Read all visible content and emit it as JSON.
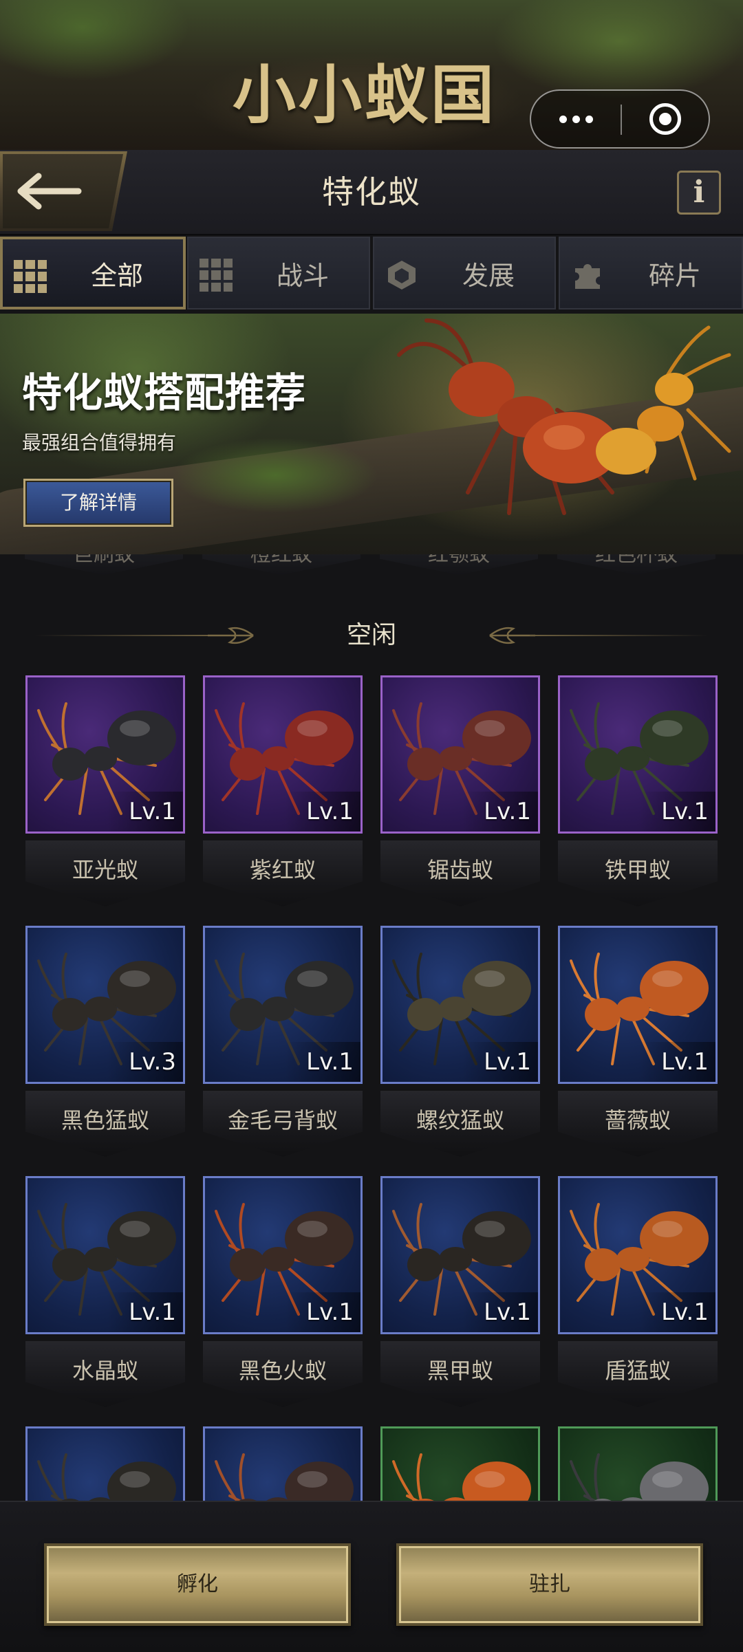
{
  "banner": {
    "logo_text": "小小蚁国"
  },
  "header": {
    "title": "特化蚁",
    "info_label": "i"
  },
  "tabs": [
    {
      "label": "全部",
      "icon": "grid-icon",
      "active": true
    },
    {
      "label": "战斗",
      "icon": "grid-icon",
      "active": false
    },
    {
      "label": "发展",
      "icon": "hexagon-icon",
      "active": false
    },
    {
      "label": "碎片",
      "icon": "puzzle-icon",
      "active": false
    }
  ],
  "promo": {
    "title": "特化蚁搭配推荐",
    "subtitle": "最强组合值得拥有",
    "button": "了解详情"
  },
  "partial_row": [
    "巨刷蚁",
    "橙红蚁",
    "红颚蚁",
    "红色杯蚁"
  ],
  "section": {
    "title": "空闲"
  },
  "ants": [
    {
      "name": "亚光蚁",
      "level": "Lv.1",
      "rarity": "purple",
      "body_color": "#2a2a2e",
      "leg_color": "#c07030"
    },
    {
      "name": "紫红蚁",
      "level": "Lv.1",
      "rarity": "purple",
      "body_color": "#8a2a22",
      "leg_color": "#a03428"
    },
    {
      "name": "锯齿蚁",
      "level": "Lv.1",
      "rarity": "purple",
      "body_color": "#6a2e26",
      "leg_color": "#8a3c30"
    },
    {
      "name": "铁甲蚁",
      "level": "Lv.1",
      "rarity": "purple",
      "body_color": "#2e3a26",
      "leg_color": "#3a4430"
    },
    {
      "name": "黑色猛蚁",
      "level": "Lv.3",
      "rarity": "blue",
      "body_color": "#2e2a26",
      "leg_color": "#3a3530"
    },
    {
      "name": "金毛弓背蚁",
      "level": "Lv.1",
      "rarity": "blue",
      "body_color": "#2a2a2a",
      "leg_color": "#3a3632"
    },
    {
      "name": "螺纹猛蚁",
      "level": "Lv.1",
      "rarity": "blue",
      "body_color": "#4a4432",
      "leg_color": "#2a2820"
    },
    {
      "name": "蔷薇蚁",
      "level": "Lv.1",
      "rarity": "blue",
      "body_color": "#c05a22",
      "leg_color": "#d87a32"
    },
    {
      "name": "水晶蚁",
      "level": "Lv.1",
      "rarity": "blue",
      "body_color": "#2a2824",
      "leg_color": "#36322c"
    },
    {
      "name": "黑色火蚁",
      "level": "Lv.1",
      "rarity": "blue",
      "body_color": "#3a2a24",
      "leg_color": "#b04a22"
    },
    {
      "name": "黑甲蚁",
      "level": "Lv.1",
      "rarity": "blue",
      "body_color": "#2a2622",
      "leg_color": "#a05a30"
    },
    {
      "name": "盾猛蚁",
      "level": "Lv.1",
      "rarity": "blue",
      "body_color": "#b85a20",
      "leg_color": "#c8702c"
    },
    {
      "name": "",
      "level": "",
      "rarity": "blue",
      "body_color": "#2a2824",
      "leg_color": "#3a3630"
    },
    {
      "name": "",
      "level": "",
      "rarity": "blue",
      "body_color": "#3a2a26",
      "leg_color": "#a0502a"
    },
    {
      "name": "",
      "level": "",
      "rarity": "green",
      "body_color": "#c85a20",
      "leg_color": "#d06a28"
    },
    {
      "name": "",
      "level": "",
      "rarity": "green",
      "body_color": "#6a6a6e",
      "leg_color": "#3a3a3e"
    }
  ],
  "actions": {
    "hatch": "孵化",
    "station": "驻扎"
  },
  "colors": {
    "accent_gold": "#b9a676",
    "blue_frame": "#6a7cc8",
    "purple_frame": "#9a62c8",
    "green_frame": "#4f9a58"
  }
}
